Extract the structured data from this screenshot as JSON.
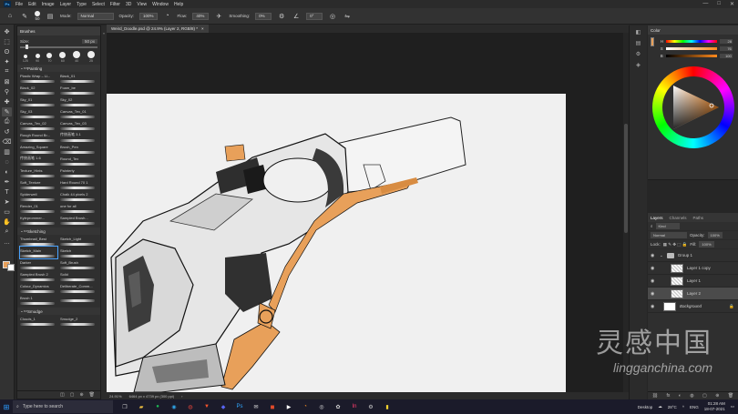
{
  "menubar": {
    "logo": "Ps",
    "items": [
      "File",
      "Edit",
      "Image",
      "Layer",
      "Type",
      "Select",
      "Filter",
      "3D",
      "View",
      "Window",
      "Help"
    ],
    "window_controls": [
      "—",
      "□",
      "✕"
    ]
  },
  "options": {
    "brush_size": "50",
    "mode_label": "Mode:",
    "mode_value": "Normal",
    "opacity_label": "Opacity:",
    "opacity_value": "100%",
    "flow_label": "Flow:",
    "flow_value": "40%",
    "smoothing_label": "Smoothing:",
    "smoothing_value": "0%",
    "angle_value": "0°"
  },
  "toolbar": {
    "tools": [
      "move-icon",
      "marquee-icon",
      "lasso-icon",
      "magic-wand-icon",
      "crop-icon",
      "frame-icon",
      "eyedropper-icon",
      "healing-icon",
      "brush-icon",
      "stamp-icon",
      "history-brush-icon",
      "eraser-icon",
      "gradient-icon",
      "blur-icon",
      "dodge-icon",
      "pen-icon",
      "type-icon",
      "path-select-icon",
      "rectangle-icon",
      "hand-icon",
      "zoom-icon",
      "more-icon"
    ],
    "tool_glyphs": [
      "✥",
      "⬚",
      "ʘ",
      "✦",
      "⌗",
      "⊠",
      "⚲",
      "✚",
      "✎",
      "⎙",
      "↺",
      "⌫",
      "▥",
      "◌",
      "◐",
      "✒",
      "T",
      "➤",
      "▭",
      "✋",
      "⌕",
      "…"
    ],
    "foreground_color": "#e8a05a",
    "background_color": "#ffffff"
  },
  "brushes": {
    "tab_label": "Brushes",
    "size_label": "Size:",
    "size_value": "50 px",
    "tips": [
      {
        "label": "125",
        "d": 4
      },
      {
        "label": "90",
        "d": 5
      },
      {
        "label": "70",
        "d": 6
      },
      {
        "label": "60",
        "d": 7
      },
      {
        "label": "40",
        "d": 8
      },
      {
        "label": "25",
        "d": 8
      }
    ],
    "groups": [
      {
        "name": "Painting",
        "items": [
          "Plastic Wrap – Li...",
          "Black_01",
          "Black_02",
          "Foam_be",
          "Sky_01",
          "Sky_02",
          "Sky_03",
          "Canvas_Tex_01",
          "Canvas_Tex_02",
          "Canvas_Tex_03",
          "Rough Round Br...",
          "传统画笔 3.1",
          "Amazing_Square",
          "Brush_Pen",
          "传统画笔 1.6",
          "Round_Tex",
          "Texture_Hints",
          "Painterly",
          "Soft_Texture",
          "Hard Round 70 1",
          "Spiderwell",
          "Chalk 44 pixels 2",
          "Render_01",
          "one for all",
          "Kyleprommer...",
          "Sampled Brush..."
        ]
      },
      {
        "name": "Sketching",
        "items": [
          "Thumbnail_Best",
          "Sketch_Light",
          "Sketch_Main",
          "Sketch",
          "Darker",
          "Soft_Brush",
          "Sampled Brush 2",
          "Solid",
          "Colour_Dynamics",
          "Deliberate_Comm...",
          "Brush 1",
          ""
        ]
      },
      {
        "name": "Smudge",
        "items": [
          "Clouds_1",
          "Smudge_2"
        ]
      }
    ],
    "selected_item": "Sketch_Main",
    "footer_icons": [
      "◫",
      "▢",
      "⊕",
      "🗑"
    ]
  },
  "document": {
    "tab_title": "Weird_Doodle.psd @ 24.9% (Layer 2, RGB/8) *",
    "close_glyph": "×",
    "zoom": "24.91%",
    "dimensions": "6464 px x 4739 px (300 ppi)",
    "status_arrow": "›"
  },
  "mini_strip_icons": [
    "◧",
    "▤",
    "⚙",
    "◈"
  ],
  "color": {
    "tab_label": "Color",
    "rows": [
      {
        "label": "H",
        "value": "28"
      },
      {
        "label": "S",
        "value": "76"
      },
      {
        "label": "B",
        "value": "100"
      }
    ],
    "swatch": "#e8a05a"
  },
  "layers": {
    "tabs": [
      "Layers",
      "Channels",
      "Paths"
    ],
    "kind_label": "Kind",
    "blend_mode": "Normal",
    "opacity_label": "Opacity:",
    "opacity_value": "100%",
    "lock_label": "Lock:",
    "fill_label": "Fill:",
    "fill_value": "100%",
    "items": [
      {
        "name": "Group 1",
        "type": "group"
      },
      {
        "name": "Layer 1 copy",
        "type": "layer"
      },
      {
        "name": "Layer 1",
        "type": "layer"
      },
      {
        "name": "Layer 2",
        "type": "layer"
      },
      {
        "name": "Background",
        "type": "background"
      }
    ],
    "active": "Layer 2",
    "footer_icons": [
      "⛓",
      "fx",
      "◐",
      "◍",
      "▢",
      "⊕",
      "🗑"
    ]
  },
  "taskbar": {
    "start_glyph": "⊞",
    "search_placeholder": "Type here to search",
    "apps": [
      {
        "name": "task-view-icon",
        "glyph": "❐",
        "color": "#cccccc"
      },
      {
        "name": "explorer-icon",
        "glyph": "▰",
        "color": "#f0c040"
      },
      {
        "name": "spotify-icon",
        "glyph": "●",
        "color": "#1db954"
      },
      {
        "name": "edge-icon",
        "glyph": "◉",
        "color": "#2fa3e6"
      },
      {
        "name": "chrome-icon",
        "glyph": "◍",
        "color": "#e0443a"
      },
      {
        "name": "brave-icon",
        "glyph": "▼",
        "color": "#fb542b"
      },
      {
        "name": "discord-icon",
        "glyph": "◆",
        "color": "#5865f2"
      },
      {
        "name": "photoshop-icon",
        "glyph": "Ps",
        "color": "#31a8ff"
      },
      {
        "name": "mail-icon",
        "glyph": "✉",
        "color": "#dddddd"
      },
      {
        "name": "office-icon",
        "glyph": "◼",
        "color": "#e04a2a"
      },
      {
        "name": "media-icon",
        "glyph": "▶",
        "color": "#ffffff"
      },
      {
        "name": "blender-icon",
        "glyph": "◔",
        "color": "#f08a24"
      },
      {
        "name": "obs-icon",
        "glyph": "◎",
        "color": "#dddddd"
      },
      {
        "name": "davinci-icon",
        "glyph": "✿",
        "color": "#dddddd"
      },
      {
        "name": "indesign-icon",
        "glyph": "In",
        "color": "#ff3d6e"
      },
      {
        "name": "settings-icon",
        "glyph": "⚙",
        "color": "#cccccc"
      },
      {
        "name": "sticky-icon",
        "glyph": "▮",
        "color": "#f5d330"
      }
    ],
    "desktop_label": "Desktop",
    "weather": "28°C",
    "lang": "ENG",
    "time": "01:28 AM",
    "date": "18-07-2021"
  },
  "watermark": {
    "cn": "灵感中国",
    "en": "lingganchina.com"
  }
}
